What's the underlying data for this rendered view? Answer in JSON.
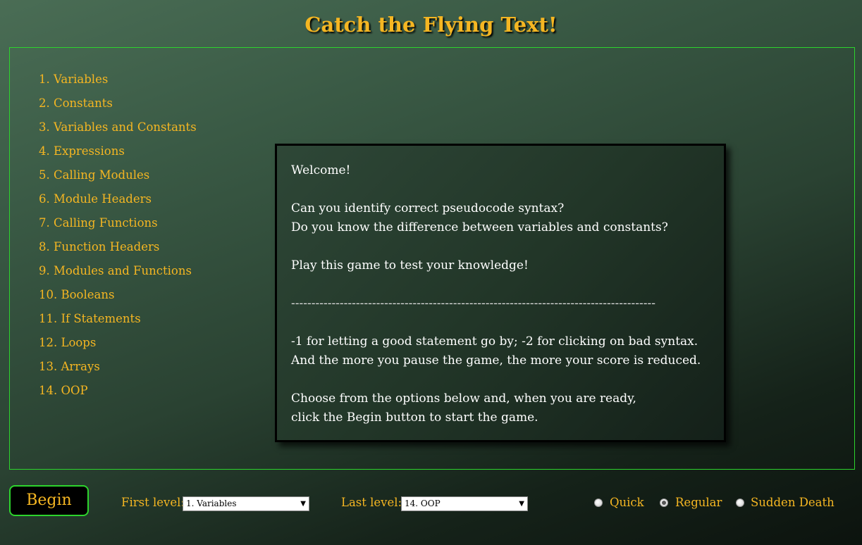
{
  "title": "Catch the Flying Text!",
  "levels": [
    "1. Variables",
    "2. Constants",
    "3. Variables and Constants",
    "4. Expressions",
    "5. Calling Modules",
    "6. Module Headers",
    "7. Calling Functions",
    "8. Function Headers",
    "9. Modules and Functions",
    "10. Booleans",
    "11. If Statements",
    "12. Loops",
    "13. Arrays",
    "14. OOP"
  ],
  "welcome": {
    "greeting": "Welcome!",
    "question1": "Can you identify correct pseudocode syntax?",
    "question2": "Do you know the difference between variables and constants?",
    "invite": "Play this game to test your knowledge!",
    "divider": "------------------------------------------------------------------------------------------",
    "scoring1": "-1 for letting a good statement go by; -2 for clicking on bad syntax.",
    "scoring2": "And the more you pause the game, the more your score is reduced.",
    "instructions1": "Choose from the options below and, when you are ready,",
    "instructions2": "click the Begin button to start the game."
  },
  "controls": {
    "begin_label": "Begin",
    "first_level_label": "First level:",
    "first_level_value": "1. Variables",
    "last_level_label": "Last level:",
    "last_level_value": "14. OOP",
    "modes": [
      {
        "label": "Quick",
        "checked": false
      },
      {
        "label": "Regular",
        "checked": true
      },
      {
        "label": "Sudden Death",
        "checked": false
      }
    ]
  },
  "colors": {
    "accent": "#f5b622",
    "border_green": "#2dd42d"
  }
}
